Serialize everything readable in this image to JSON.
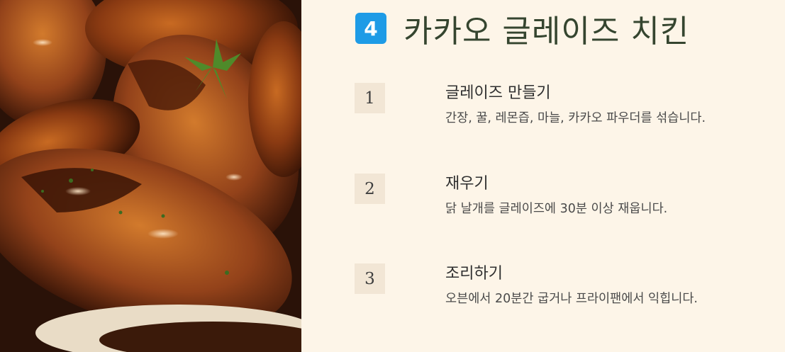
{
  "photo": {
    "alt": "glazed chicken wings"
  },
  "header": {
    "number": "4",
    "title": "카카오 글레이즈 치킨"
  },
  "steps": [
    {
      "num": "1",
      "title": "글레이즈 만들기",
      "desc": "간장, 꿀, 레몬즙, 마늘, 카카오 파우더를 섞습니다."
    },
    {
      "num": "2",
      "title": "재우기",
      "desc": "닭 날개를 글레이즈에 30분 이상 재웁니다."
    },
    {
      "num": "3",
      "title": "조리하기",
      "desc": "오븐에서 20분간 굽거나 프라이팬에서 익힙니다."
    }
  ],
  "colors": {
    "background": "#fdf5e8",
    "badge": "#1e9be6",
    "title": "#35452f",
    "step_box": "#f2e6d5"
  }
}
